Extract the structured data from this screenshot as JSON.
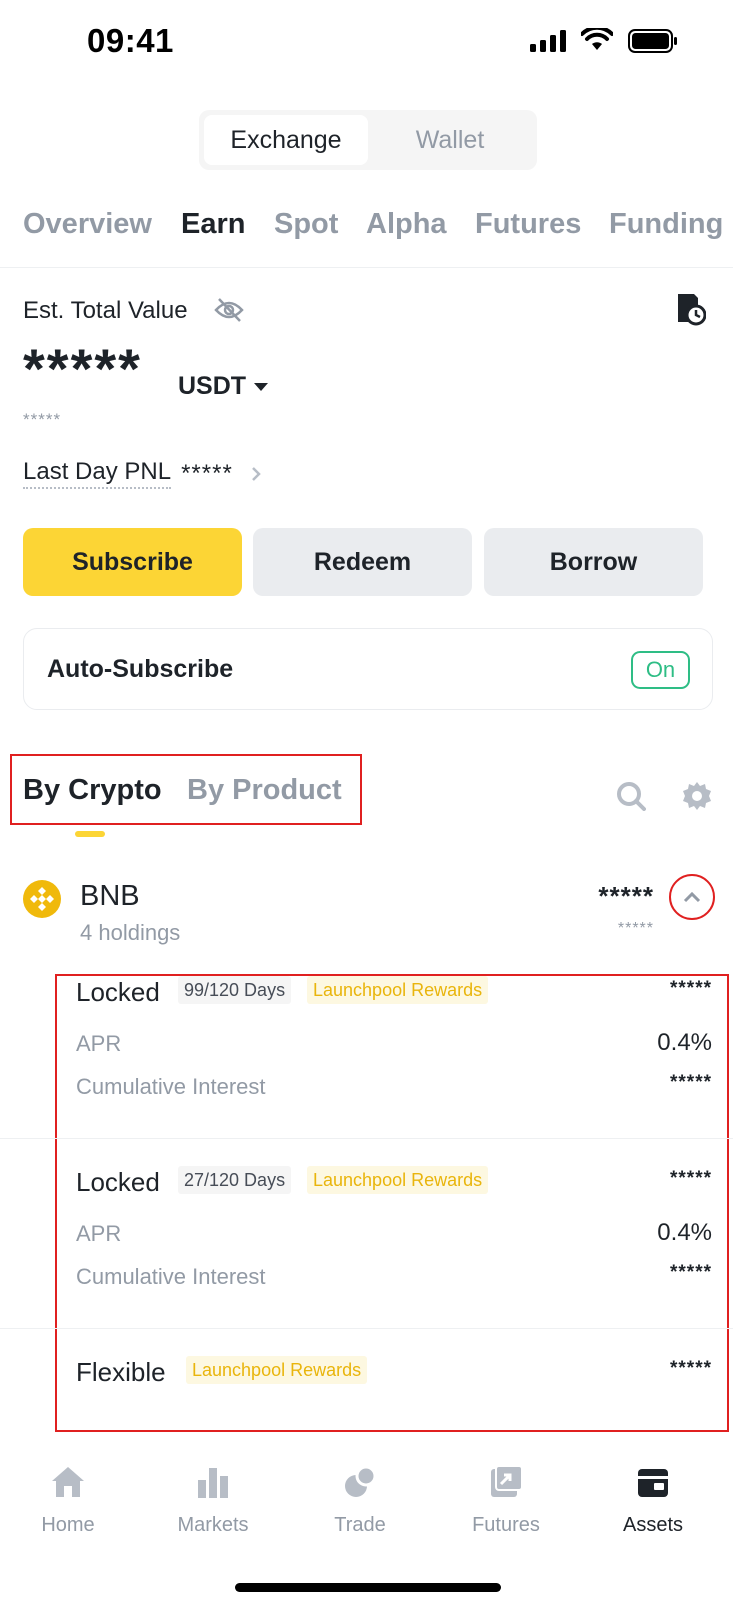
{
  "status_bar": {
    "time": "09:41"
  },
  "mode_switch": {
    "active": "Exchange",
    "inactive": "Wallet"
  },
  "tabs": [
    {
      "label": "Overview",
      "active": false
    },
    {
      "label": "Earn",
      "active": true
    },
    {
      "label": "Spot",
      "active": false
    },
    {
      "label": "Alpha",
      "active": false
    },
    {
      "label": "Futures",
      "active": false
    },
    {
      "label": "Funding",
      "active": false
    }
  ],
  "summary": {
    "est_label": "Est. Total Value",
    "value": "*****",
    "currency": "USDT",
    "sub_value": "*****",
    "pnl_label": "Last Day PNL",
    "pnl_value": "*****"
  },
  "actions": {
    "subscribe": "Subscribe",
    "redeem": "Redeem",
    "borrow": "Borrow"
  },
  "auto_subscribe": {
    "label": "Auto-Subscribe",
    "state": "On"
  },
  "sub_tabs": {
    "active": "By Crypto",
    "inactive": "By Product"
  },
  "asset": {
    "name": "BNB",
    "holdings_count": "4 holdings",
    "value": "*****",
    "sub_value": "*****"
  },
  "holdings": [
    {
      "type": "Locked",
      "days": "99/120 Days",
      "tag": "Launchpool Rewards",
      "amount": "*****",
      "apr_label": "APR",
      "apr": "0.4%",
      "interest_label": "Cumulative Interest",
      "interest": "*****"
    },
    {
      "type": "Locked",
      "days": "27/120 Days",
      "tag": "Launchpool Rewards",
      "amount": "*****",
      "apr_label": "APR",
      "apr": "0.4%",
      "interest_label": "Cumulative Interest",
      "interest": "*****"
    },
    {
      "type": "Flexible",
      "tag": "Launchpool Rewards",
      "amount": "*****"
    }
  ],
  "bottom_nav": [
    {
      "label": "Home",
      "icon": "home-icon",
      "active": false
    },
    {
      "label": "Markets",
      "icon": "bar-chart-icon",
      "active": false
    },
    {
      "label": "Trade",
      "icon": "trade-icon",
      "active": false
    },
    {
      "label": "Futures",
      "icon": "futures-icon",
      "active": false
    },
    {
      "label": "Assets",
      "icon": "wallet-icon",
      "active": true
    }
  ],
  "colors": {
    "accent": "#fcd535",
    "text": "#1e2329",
    "muted": "#929aa5",
    "green": "#2ebd85",
    "highlight_red": "#e02020",
    "reward_tag": "#e9b50c"
  }
}
